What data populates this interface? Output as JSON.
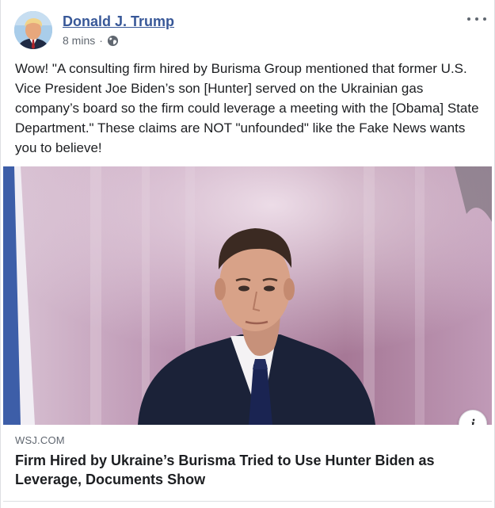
{
  "post": {
    "author": "Donald J. Trump",
    "timestamp": "8 mins",
    "separator": "·",
    "audience_icon": "globe-icon",
    "text": "Wow! \"A consulting firm hired by Burisma Group mentioned that former U.S. Vice President Joe Biden’s son [Hunter] served on the Ukrainian gas company’s board so the firm could leverage a meeting with the [Obama] State Department.\" These claims are NOT \"unfounded\" like the Fake News wants you to believe!"
  },
  "link_preview": {
    "domain": "WSJ.COM",
    "headline": "Firm Hired by Ukraine’s Burisma Tried to Use Hunter Biden as Leverage, Documents Show",
    "info_glyph": "i"
  },
  "colors": {
    "author_link": "#385898",
    "meta_text": "#606770",
    "body_text": "#1c1e21",
    "border": "#dddfe2"
  }
}
